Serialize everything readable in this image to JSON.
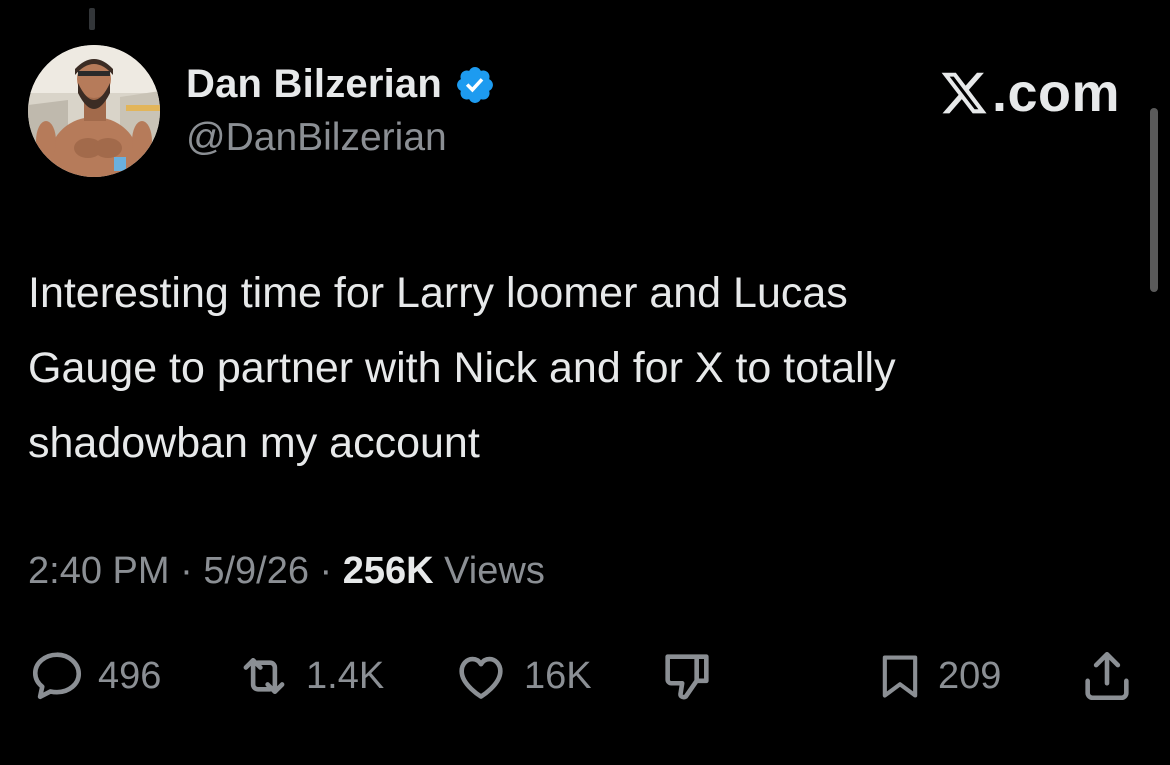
{
  "author": {
    "display_name": "Dan Bilzerian",
    "handle": "@DanBilzerian",
    "verified": true,
    "verified_color": "#1d9bf0"
  },
  "brand": {
    "logo_icon": "x-logo-icon",
    "text": ".com"
  },
  "tweet": {
    "text": "Interesting time for Larry loomer and Lucas\nGauge to partner with Nick and for X to totally\nshadowban my account",
    "time": "2:40 PM",
    "separator": " · ",
    "date": "5/9/26",
    "views_count": "256K",
    "views_label": " Views"
  },
  "actions": {
    "reply": {
      "icon": "reply-icon",
      "count": "496"
    },
    "repost": {
      "icon": "repost-icon",
      "count": "1.4K"
    },
    "like": {
      "icon": "like-icon",
      "count": "16K"
    },
    "dislike": {
      "icon": "dislike-icon"
    },
    "bookmark": {
      "icon": "bookmark-icon",
      "count": "209"
    },
    "share": {
      "icon": "share-icon"
    }
  },
  "colors": {
    "background": "#000000",
    "primary_text": "#e7e9ea",
    "secondary_text": "#8b8f94"
  }
}
